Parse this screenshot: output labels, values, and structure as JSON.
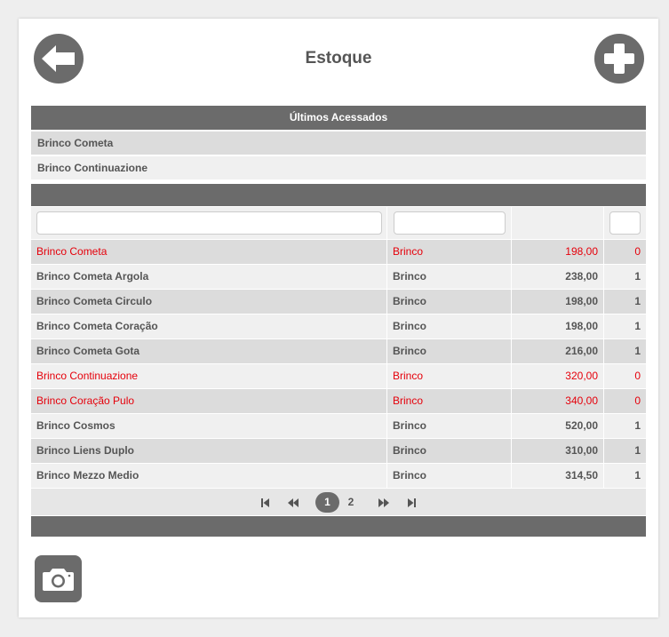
{
  "header": {
    "title": "Estoque",
    "back_icon": "arrow-left-icon",
    "add_icon": "plus-icon"
  },
  "recent": {
    "title": "Últimos Acessados",
    "items": [
      "Brinco Cometa",
      "Brinco Continuazione"
    ]
  },
  "table": {
    "filters": {
      "name_value": "",
      "category_value": "",
      "stock_value": ""
    },
    "rows": [
      {
        "name": "Brinco Cometa",
        "category": "Brinco",
        "price": "198,00",
        "stock": "0"
      },
      {
        "name": "Brinco Cometa Argola",
        "category": "Brinco",
        "price": "238,00",
        "stock": "1"
      },
      {
        "name": "Brinco Cometa Circulo",
        "category": "Brinco",
        "price": "198,00",
        "stock": "1"
      },
      {
        "name": "Brinco Cometa Coração",
        "category": "Brinco",
        "price": "198,00",
        "stock": "1"
      },
      {
        "name": "Brinco Cometa Gota",
        "category": "Brinco",
        "price": "216,00",
        "stock": "1"
      },
      {
        "name": "Brinco Continuazione",
        "category": "Brinco",
        "price": "320,00",
        "stock": "0"
      },
      {
        "name": "Brinco Coração Pulo",
        "category": "Brinco",
        "price": "340,00",
        "stock": "0"
      },
      {
        "name": "Brinco Cosmos",
        "category": "Brinco",
        "price": "520,00",
        "stock": "1"
      },
      {
        "name": "Brinco Liens Duplo",
        "category": "Brinco",
        "price": "310,00",
        "stock": "1"
      },
      {
        "name": "Brinco Mezzo Medio",
        "category": "Brinco",
        "price": "314,50",
        "stock": "1"
      }
    ]
  },
  "pagination": {
    "first_icon": "first-page-icon",
    "prev_icon": "previous-page-icon",
    "next_icon": "next-page-icon",
    "last_icon": "last-page-icon",
    "pages": [
      "1",
      "2"
    ],
    "current": "1"
  },
  "footer": {
    "camera_icon": "camera-icon"
  },
  "colors": {
    "primary_gray": "#6b6b6b",
    "out_of_stock_red": "#e5000b",
    "row_odd": "#dcdcdc",
    "row_even": "#f0f0f0"
  }
}
